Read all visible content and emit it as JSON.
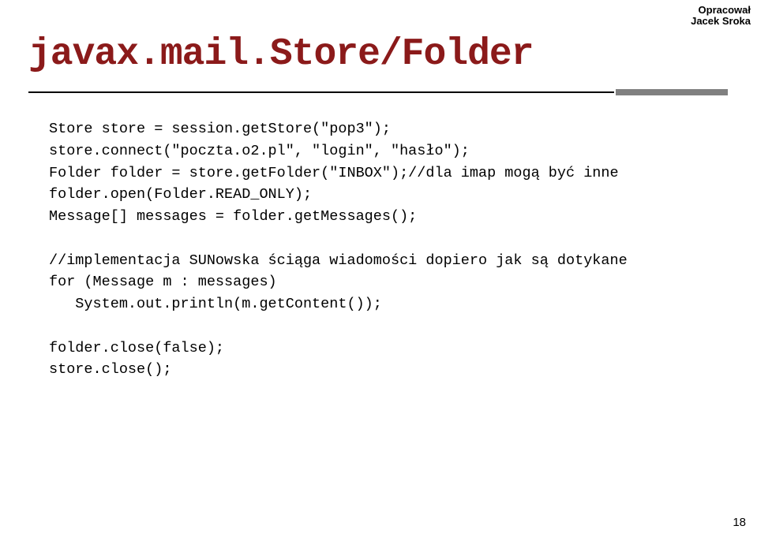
{
  "credit": {
    "line1": "Opracował",
    "line2": "Jacek Sroka"
  },
  "title": "javax.mail.Store/Folder",
  "code": {
    "l1": "Store store = session.getStore(\"pop3\");",
    "l2": "store.connect(\"poczta.o2.pl\", \"login\", \"hasło\");",
    "l3": "Folder folder = store.getFolder(\"INBOX\");//dla imap mogą być inne",
    "l4": "folder.open(Folder.READ_ONLY);",
    "l5": "Message[] messages = folder.getMessages();",
    "l6": "",
    "l7": "//implementacja SUNowska ściąga wiadomości dopiero jak są dotykane",
    "l8": "for (Message m : messages)",
    "l9": "   System.out.println(m.getContent());",
    "l10": "",
    "l11": "folder.close(false);",
    "l12": "store.close();"
  },
  "page_number": "18"
}
